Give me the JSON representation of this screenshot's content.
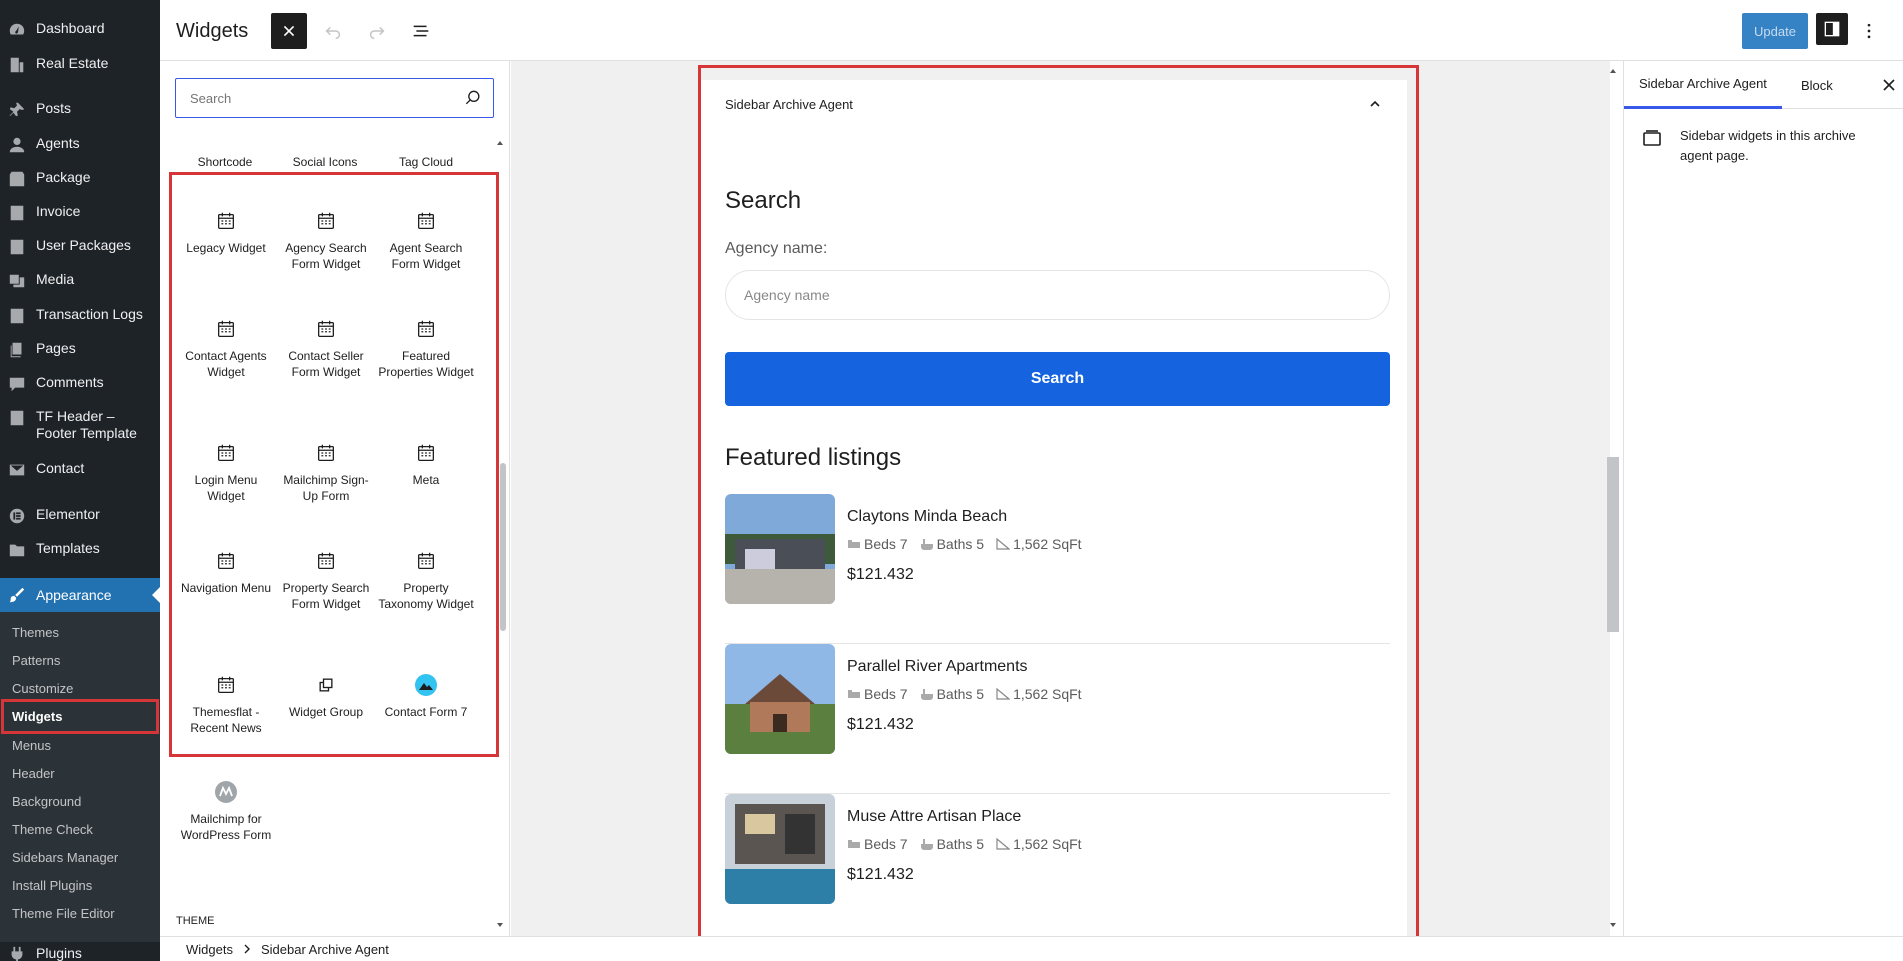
{
  "admin_menu": {
    "items": [
      {
        "label": "Dashboard",
        "icon": "dashboard-icon"
      },
      {
        "label": "Real Estate",
        "icon": "building-icon"
      },
      {
        "label": "Posts",
        "icon": "pin-icon"
      },
      {
        "label": "Agents",
        "icon": "user-icon"
      },
      {
        "label": "Package",
        "icon": "package-icon"
      },
      {
        "label": "Invoice",
        "icon": "document-icon"
      },
      {
        "label": "User Packages",
        "icon": "document-icon"
      },
      {
        "label": "Media",
        "icon": "media-icon"
      },
      {
        "label": "Transaction Logs",
        "icon": "document-icon"
      },
      {
        "label": "Pages",
        "icon": "pages-icon"
      },
      {
        "label": "Comments",
        "icon": "comment-icon"
      },
      {
        "label": "TF Header – Footer Template",
        "icon": "document-icon"
      },
      {
        "label": "Contact",
        "icon": "email-icon"
      },
      {
        "label": "Elementor",
        "icon": "elementor-icon"
      },
      {
        "label": "Templates",
        "icon": "folder-icon"
      }
    ],
    "appearance": "Appearance",
    "submenu": [
      "Themes",
      "Patterns",
      "Customize",
      "Widgets",
      "Menus",
      "Header",
      "Background",
      "Theme Check",
      "Sidebars Manager",
      "Install Plugins",
      "Theme File Editor"
    ],
    "plugins": "Plugins"
  },
  "topbar": {
    "title": "Widgets",
    "update_label": "Update"
  },
  "inserter": {
    "search_placeholder": "Search",
    "top_row": [
      "Shortcode",
      "Social Icons",
      "Tag Cloud"
    ],
    "blocks": [
      "Legacy Widget",
      "Agency Search Form Widget",
      "Agent Search Form Widget",
      "Contact Agents Widget",
      "Contact Seller Form Widget",
      "Featured Properties Widget",
      "Login Menu Widget",
      "Mailchimp Sign-Up Form",
      "Meta",
      "Navigation Menu",
      "Property Search Form Widget",
      "Property Taxonomy Widget",
      "Themesflat - Recent News",
      "Widget Group",
      "Contact Form 7",
      "Mailchimp for WordPress Form"
    ],
    "theme_label": "THEME"
  },
  "widget_area": {
    "header": "Sidebar Archive Agent",
    "search_title": "Search",
    "agency_label": "Agency name:",
    "agency_placeholder": "Agency name",
    "search_button": "Search",
    "featured_title": "Featured listings",
    "listings": [
      {
        "title": "Claytons Minda Beach",
        "beds": "Beds 7",
        "baths": "Baths 5",
        "sqft": "1,562 SqFt",
        "price": "$121.432"
      },
      {
        "title": "Parallel River Apartments",
        "beds": "Beds 7",
        "baths": "Baths 5",
        "sqft": "1,562 SqFt",
        "price": "$121.432"
      },
      {
        "title": "Muse Attre Artisan Place",
        "beds": "Beds 7",
        "baths": "Baths 5",
        "sqft": "1,562 SqFt",
        "price": "$121.432"
      }
    ]
  },
  "right_panel": {
    "tab_area": "Sidebar Archive Agent",
    "tab_block": "Block",
    "description": "Sidebar widgets in this archive agent page."
  },
  "footer": {
    "crumb_1": "Widgets",
    "crumb_2": "Sidebar Archive Agent"
  },
  "colors": {
    "admin_bg": "#1d2327",
    "submenu_bg": "#2c3338",
    "accent": "#2271b1",
    "highlight_red": "#d63638",
    "search_button": "#1563df"
  }
}
